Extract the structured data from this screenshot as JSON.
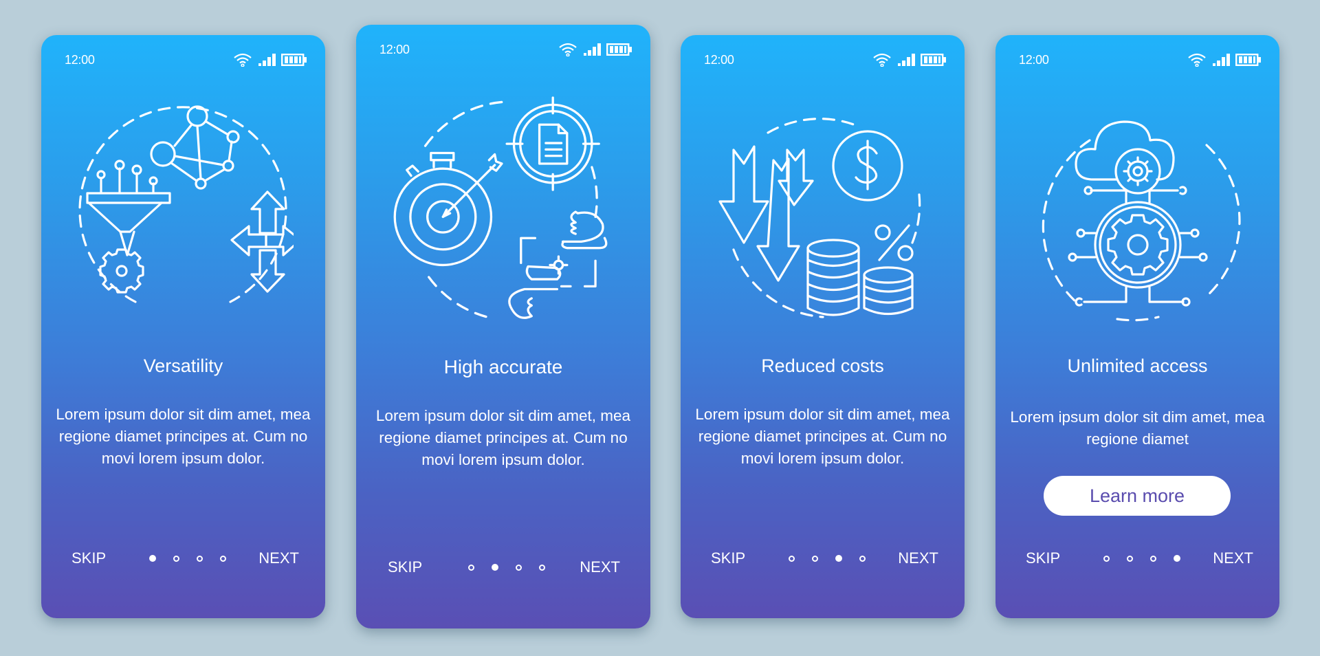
{
  "screens": [
    {
      "status": {
        "time": "12:00",
        "wifi_icon": "wifi-icon",
        "signal_icon": "signal-icon",
        "battery_icon": "battery-icon"
      },
      "illustration": "versatility-illustration",
      "title": "Versatility",
      "body": "Lorem ipsum dolor sit dim amet, mea regione diamet principes at. Cum no movi lorem ipsum dolor.",
      "nav": {
        "skip": "SKIP",
        "next": "NEXT",
        "page_count": 4,
        "active_page": 1
      }
    },
    {
      "status": {
        "time": "12:00",
        "wifi_icon": "wifi-icon",
        "signal_icon": "signal-icon",
        "battery_icon": "battery-icon"
      },
      "illustration": "accuracy-illustration",
      "title": "High accurate",
      "body": "Lorem ipsum dolor sit dim amet, mea regione diamet principes at. Cum no movi lorem ipsum dolor.",
      "nav": {
        "skip": "SKIP",
        "next": "NEXT",
        "page_count": 4,
        "active_page": 2
      }
    },
    {
      "status": {
        "time": "12:00",
        "wifi_icon": "wifi-icon",
        "signal_icon": "signal-icon",
        "battery_icon": "battery-icon"
      },
      "illustration": "reduced-costs-illustration",
      "title": "Reduced costs",
      "body": "Lorem ipsum dolor sit dim amet, mea regione diamet principes at. Cum no movi lorem ipsum dolor.",
      "nav": {
        "skip": "SKIP",
        "next": "NEXT",
        "page_count": 4,
        "active_page": 3
      }
    },
    {
      "status": {
        "time": "12:00",
        "wifi_icon": "wifi-icon",
        "signal_icon": "signal-icon",
        "battery_icon": "battery-icon"
      },
      "illustration": "unlimited-access-illustration",
      "title": "Unlimited access",
      "body": "Lorem ipsum dolor sit dim amet, mea regione diamet",
      "button": "Learn more",
      "nav": {
        "skip": "SKIP",
        "next": "NEXT",
        "page_count": 4,
        "active_page": 4
      }
    }
  ],
  "colors": {
    "background": "#b9ced9",
    "gradient_top": "#20b3fb",
    "gradient_bottom": "#5a4fb4",
    "button_text": "#5a4cae"
  }
}
